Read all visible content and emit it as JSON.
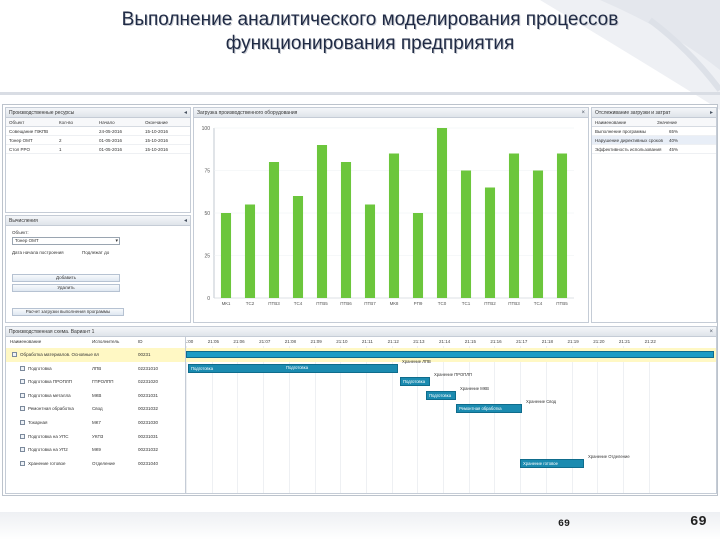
{
  "slide": {
    "title_line1": "Выполнение аналитического моделирования процессов",
    "title_line2": "функционирования предприятия",
    "page_small": "69",
    "page_big": "69"
  },
  "objects_panel": {
    "title": "Производственные ресурсы",
    "columns": [
      "Объект",
      "Кол-во",
      "Начало",
      "Окончание"
    ],
    "rows": [
      [
        "Совещание ПЖПВ",
        "",
        "24-05-2016",
        "15-10-2016"
      ],
      [
        "Тонер ОМТ",
        "2",
        "01-05-2016",
        "15-10-2016"
      ],
      [
        "Стол РРО",
        "1",
        "01-05-2016",
        "15-10-2016"
      ]
    ]
  },
  "calc_panel": {
    "title": "Вычисления",
    "field_label": "Объект:",
    "field_value": "Тонер ОМТ",
    "date_label": "Дата начала построения",
    "date_value": "Подлежат до",
    "btn_add": "Добавить",
    "btn_delete": "Удалить",
    "btn_run": "Расчет загрузки выполнения программы"
  },
  "chart_panel": {
    "title": "Загрузка производственного оборудования"
  },
  "chart_data": {
    "type": "bar",
    "categories": [
      "МК1",
      "ТС2",
      "ПТВ3",
      "ТС4",
      "ПТВ5",
      "ПТВ6",
      "ПТВ7",
      "МК8",
      "РП9",
      "ТС0",
      "ТС1",
      "ПТВ2",
      "ПТВ3",
      "ТС4",
      "ПТВ5"
    ],
    "values": [
      50,
      55,
      80,
      60,
      90,
      80,
      55,
      85,
      50,
      100,
      75,
      65,
      85,
      75,
      85
    ],
    "yticks": [
      "0",
      "25",
      "50",
      "75",
      "100"
    ],
    "ylim": [
      0,
      100
    ],
    "color": "#6cc63c"
  },
  "metrics_panel": {
    "title": "Отслеживание загрузки и затрат",
    "columns": [
      "Наименование",
      "Значение"
    ],
    "rows": [
      [
        "Выполнение программы",
        "65%"
      ],
      [
        "Нарушение директивных сроков",
        "40%"
      ],
      [
        "Эффективность использования",
        "45%"
      ]
    ]
  },
  "gantt": {
    "title": "Производственная схема. Вариант 1",
    "columns": [
      "Наименование",
      "Исполнитель",
      "ID"
    ],
    "rows": [
      {
        "name": "Обработка материалов. Основные вл",
        "exec": "",
        "id": "00231",
        "group": true
      },
      {
        "name": "Подготовка",
        "exec": "ЛПВ",
        "id": "02231010"
      },
      {
        "name": "Подготовка ПРОПЛП",
        "exec": "ГПРОЛПП",
        "id": "02231020"
      },
      {
        "name": "Подготовка металла",
        "exec": "МКВ",
        "id": "00231031"
      },
      {
        "name": "Ремонтная обработка",
        "exec": "Свод",
        "id": "00231032"
      },
      {
        "name": "Токарная",
        "exec": "МК7",
        "id": "00231030"
      },
      {
        "name": "Подготовка на УПС",
        "exec": "УКП3",
        "id": "00231031"
      },
      {
        "name": "Подготовка на УП2",
        "exec": "МК9",
        "id": "00231032"
      },
      {
        "name": "Хранение готовое",
        "exec": "Отделение",
        "id": "00231040"
      }
    ],
    "times": [
      "21:00",
      "21:05",
      "21:06",
      "21:07",
      "21:08",
      "21:09",
      "21:10",
      "21:11",
      "21:12",
      "21:13",
      "21:14",
      "21:15",
      "21:16",
      "21:17",
      "21:18",
      "21:19",
      "21:20",
      "21:21",
      "21:22"
    ],
    "bars": [
      {
        "label": "Подготовка",
        "note": "Хранение ЛПВ"
      },
      {
        "label": "Подготовка",
        "note": "Хранение ПРОПЛП"
      },
      {
        "label": "Подготовка",
        "note": "Хранение МКВ"
      },
      {
        "label": "Ремонтная обработка",
        "note": "Хранение Свод"
      },
      {
        "label": "Хранение готовое",
        "note": "Хранение Отделение"
      }
    ],
    "summary_label": "Подготовка"
  }
}
